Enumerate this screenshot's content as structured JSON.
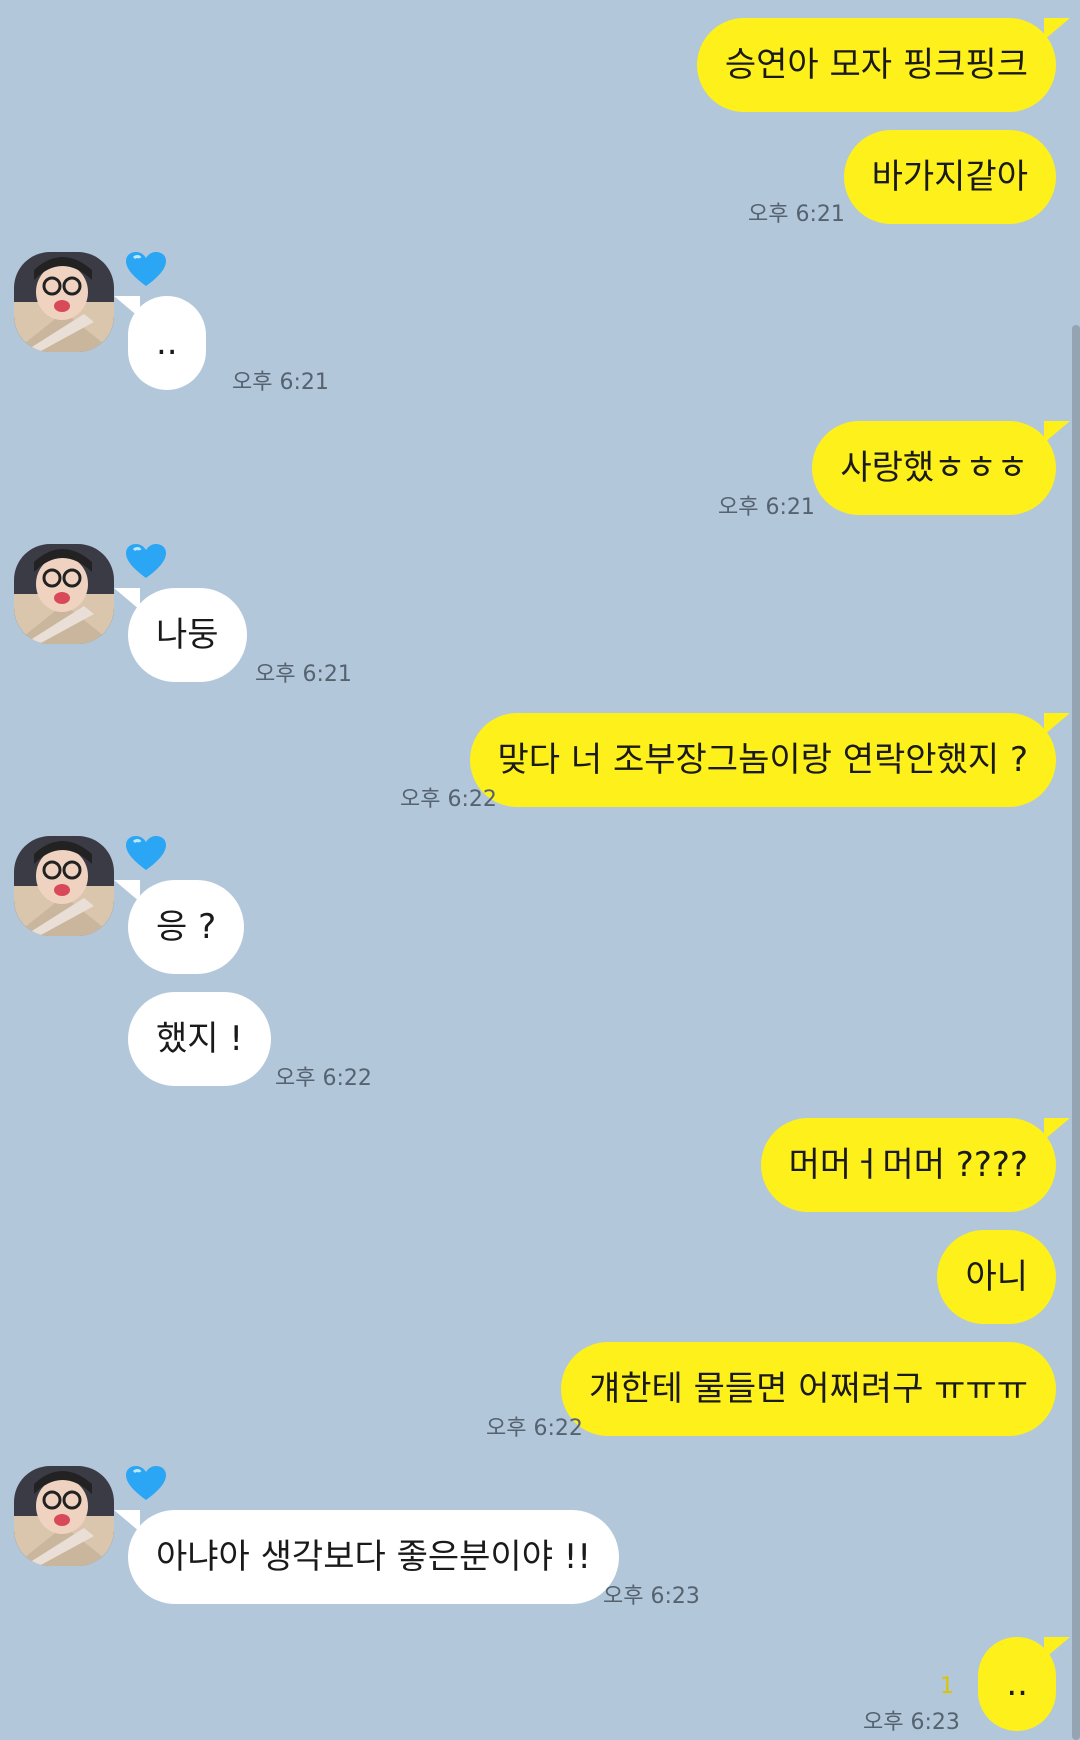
{
  "messages": [
    {
      "text": "승연아 모자 핑크핑크",
      "time": ""
    },
    {
      "text": "바가지같아",
      "time": "오후 6:21"
    },
    {
      "text": "..",
      "time": "오후 6:21"
    },
    {
      "text": "사랑했ㅎㅎㅎ",
      "time": "오후 6:21"
    },
    {
      "text": "나둥",
      "time": "오후 6:21"
    },
    {
      "text": "맞다 너 조부장그놈이랑 연락안했지 ?",
      "time": "오후 6:22"
    },
    {
      "text": "응 ?",
      "time": ""
    },
    {
      "text": "했지 !",
      "time": "오후 6:22"
    },
    {
      "text": "머머ㅓ머머 ????",
      "time": ""
    },
    {
      "text": "아니",
      "time": ""
    },
    {
      "text": "걔한테 물들면 어쩌려구 ㅠㅠㅠ",
      "time": "오후 6:22"
    },
    {
      "text": "아냐아 생각보다 좋은분이야 !!",
      "time": "오후 6:23"
    },
    {
      "text": "..",
      "time": "오후 6:23",
      "unread": "1"
    }
  ],
  "colors": {
    "background": "#b2c7da",
    "my_bubble": "#fef01b",
    "their_bubble": "#ffffff",
    "heart": "#2aa6f5"
  },
  "icons": {
    "profile": "profile-avatar",
    "badge": "blue-heart-icon"
  }
}
